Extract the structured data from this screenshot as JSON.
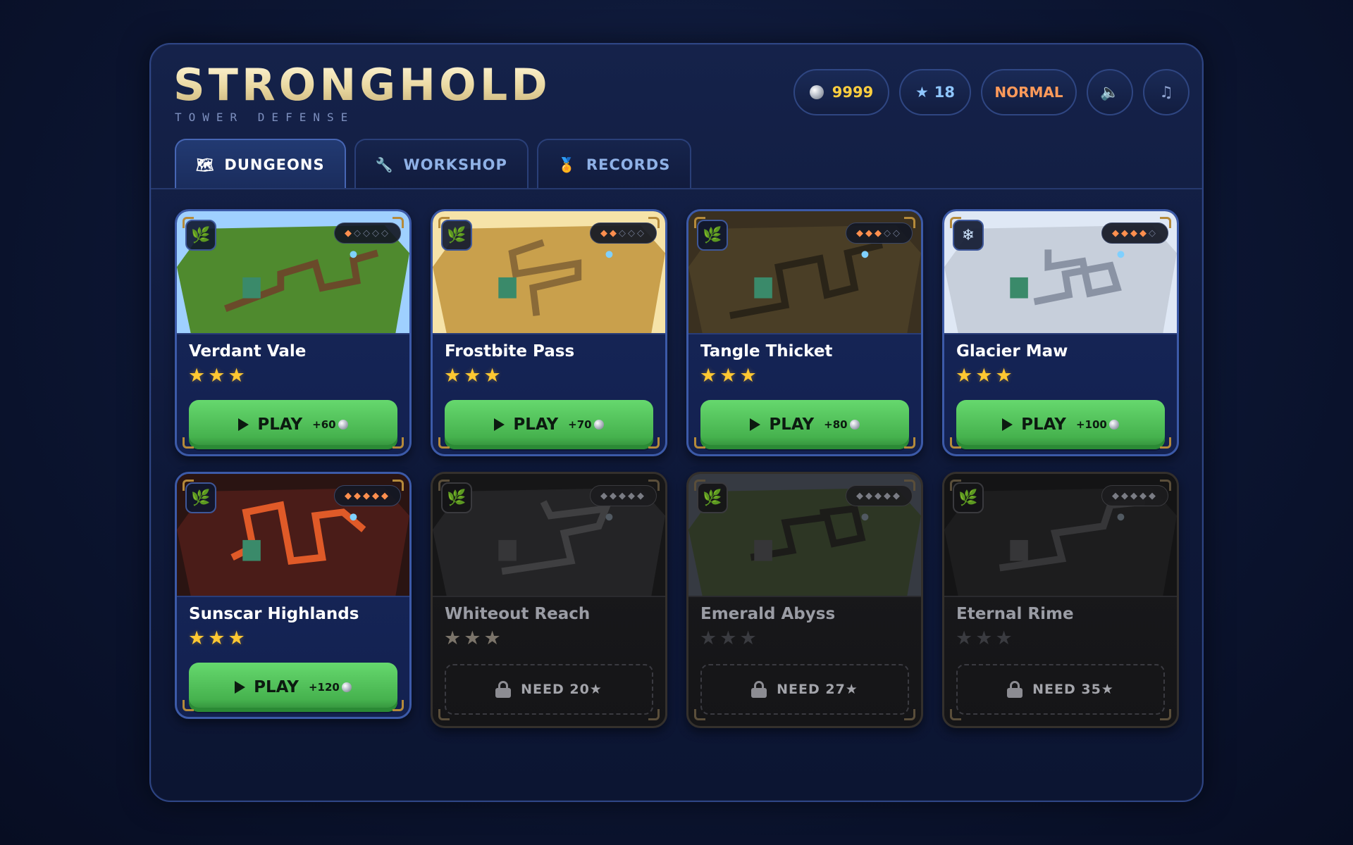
{
  "brand": {
    "title": "STRONGHOLD",
    "subtitle": "TOWER DEFENSE"
  },
  "hud": {
    "coins": "9999",
    "stars": "18",
    "mode": "NORMAL",
    "sound_icon": "speaker-icon",
    "music_icon": "music-note-icon"
  },
  "tabs": [
    {
      "label": "DUNGEONS",
      "icon": "map-icon",
      "active": true
    },
    {
      "label": "WORKSHOP",
      "icon": "wrench-icon",
      "active": false
    },
    {
      "label": "RECORDS",
      "icon": "medal-icon",
      "active": false
    }
  ],
  "levels": [
    {
      "name": "Verdant Vale",
      "biome": "leaf-icon",
      "difficulty": 1,
      "stars_earned": 3,
      "unlocked": true,
      "play_label": "PLAY",
      "reward": "+60",
      "terrain": "#4f8a2e",
      "path": "#6a4a2a",
      "sky": "#9fd0ff"
    },
    {
      "name": "Frostbite Pass",
      "biome": "leaf-icon",
      "difficulty": 2,
      "stars_earned": 3,
      "unlocked": true,
      "play_label": "PLAY",
      "reward": "+70",
      "terrain": "#c9a04c",
      "path": "#8a6a38",
      "sky": "#f6e3a8"
    },
    {
      "name": "Tangle Thicket",
      "biome": "leaf-icon",
      "difficulty": 3,
      "stars_earned": 3,
      "unlocked": true,
      "play_label": "PLAY",
      "reward": "+80",
      "terrain": "#4a3e26",
      "path": "#2a2418",
      "sky": "#3a3020"
    },
    {
      "name": "Glacier Maw",
      "biome": "snowflake-icon",
      "difficulty": 4,
      "stars_earned": 3,
      "unlocked": true,
      "play_label": "PLAY",
      "reward": "+100",
      "terrain": "#c7cfdb",
      "path": "#8a93a4",
      "sky": "#dfe8f5"
    },
    {
      "name": "Sunscar Highlands",
      "biome": "leaf-icon",
      "difficulty": 5,
      "stars_earned": 3,
      "unlocked": true,
      "play_label": "PLAY",
      "reward": "+120",
      "terrain": "#4a1c18",
      "path": "#e05a28",
      "sky": "#2a1412"
    },
    {
      "name": "Whiteout Reach",
      "biome": "leaf-icon",
      "difficulty": 5,
      "stars_earned": 3,
      "unlocked": false,
      "requirement": "NEED 20★",
      "terrain": "#3a3a3c",
      "path": "#6a6a6e",
      "sky": "#202022"
    },
    {
      "name": "Emerald Abyss",
      "biome": "leaf-icon",
      "difficulty": 5,
      "stars_earned": 0,
      "unlocked": false,
      "requirement": "NEED 27★",
      "terrain": "#4a5a3a",
      "path": "#2a2a26",
      "sky": "#5a6270"
    },
    {
      "name": "Eternal Rime",
      "biome": "leaf-icon",
      "difficulty": 5,
      "stars_earned": 0,
      "unlocked": false,
      "requirement": "NEED 35★",
      "terrain": "#2c2c2e",
      "path": "#5a5a5e",
      "sky": "#1c1c1e"
    }
  ]
}
